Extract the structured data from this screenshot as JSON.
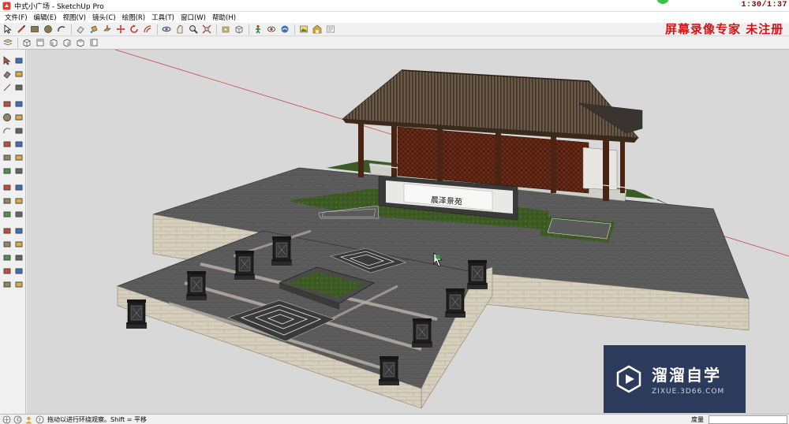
{
  "window": {
    "title": "中式小广场 - SketchUp Pro",
    "clock": "1:30/1:37"
  },
  "menu": [
    "文件(F)",
    "编辑(E)",
    "视图(V)",
    "镜头(C)",
    "绘图(R)",
    "工具(T)",
    "窗口(W)",
    "帮助(H)"
  ],
  "toolbar_row1": [
    "select-arrow",
    "pencil-line",
    "rectangle",
    "circle",
    "arc",
    "sep",
    "eraser",
    "paint-bucket",
    "push-pull",
    "move",
    "rotate",
    "offset",
    "sep",
    "orbit",
    "pan",
    "zoom",
    "zoom-extents",
    "sep",
    "section-plane",
    "component",
    "sep",
    "person-walk",
    "look-around",
    "position-camera",
    "sep",
    "photo-texture",
    "warehouse",
    "styles"
  ],
  "toolbar_row2": [
    "layers",
    "iso-view",
    "top-view",
    "front-view",
    "right-view",
    "back-view",
    "left-view"
  ],
  "recorder_watermark": "屏幕录像专家  未注册",
  "left_tools": [
    [
      "select",
      "make-component"
    ],
    [
      "eraser",
      "paint"
    ],
    [
      "line",
      "freehand"
    ],
    [
      "rectangle",
      "rotated-rect"
    ],
    [
      "circle",
      "polygon"
    ],
    [
      "arc",
      "pie"
    ],
    [
      "push-pull",
      "follow-me"
    ],
    [
      "move",
      "rotate"
    ],
    [
      "scale",
      "offset"
    ],
    [
      "tape",
      "dimension"
    ],
    [
      "protractor",
      "text"
    ],
    [
      "axes",
      "3d-text"
    ],
    [
      "orbit",
      "pan"
    ],
    [
      "zoom",
      "zoom-window"
    ],
    [
      "zoom-extents",
      "prev-view"
    ],
    [
      "position-camera",
      "walk"
    ],
    [
      "look-around",
      "section"
    ]
  ],
  "scene": {
    "sign_text": "晨泽景苑"
  },
  "logo": {
    "name_cn": "溜溜自学",
    "url": "ZIXUE.3D66.COM"
  },
  "status": {
    "text": "拖动以进行环绕观察。Shift = 平移",
    "measure_label": "度量",
    "measure_value": ""
  },
  "colors": {
    "accent_red": "#d41414",
    "logo_bg": "#2c3a5c",
    "viewport_bg": "#d8d8d8"
  }
}
